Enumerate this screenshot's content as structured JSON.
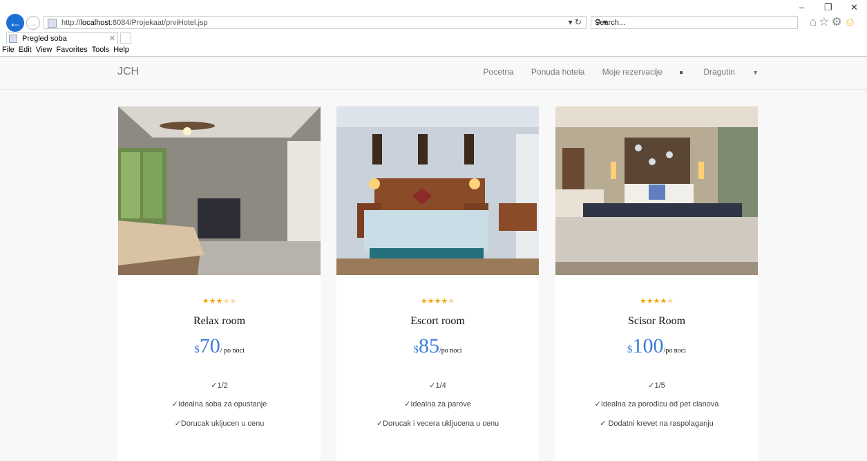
{
  "browser": {
    "url_prefix": "http://",
    "url_host": "localhost",
    "url_rest": ":8084/Projekaat/prviHotel.jsp",
    "search_placeholder": "Search...",
    "tab_title": "Pregled soba",
    "menu": [
      "File",
      "Edit",
      "View",
      "Favorites",
      "Tools",
      "Help"
    ]
  },
  "navbar": {
    "brand": "JCH",
    "links": [
      "Pocetna",
      "Ponuda hotela",
      "Moje rezervacije"
    ],
    "user": "Dragutin"
  },
  "rooms": [
    {
      "stars": 3,
      "name": "Relax room",
      "currency": "$",
      "price": "70",
      "per": "/ po noci",
      "features": [
        "✓1/2",
        "✓Idealna soba za opustanje",
        "✓Dorucak ukljucen u cenu"
      ]
    },
    {
      "stars": 4,
      "name": "Escort room",
      "currency": "$",
      "price": "85",
      "per": "/po noci",
      "features": [
        "✓1/4",
        "✓Idealna za parove",
        "✓Dorucak i vecera ukljucena u cenu"
      ]
    },
    {
      "stars": 4,
      "name": "Scisor Room",
      "currency": "$",
      "price": "100",
      "per": "/po noci",
      "features": [
        "✓1/5",
        "✓Idealna za porodicu od pet clanova",
        "✓ Dodatni krevet na raspolaganju"
      ]
    }
  ]
}
